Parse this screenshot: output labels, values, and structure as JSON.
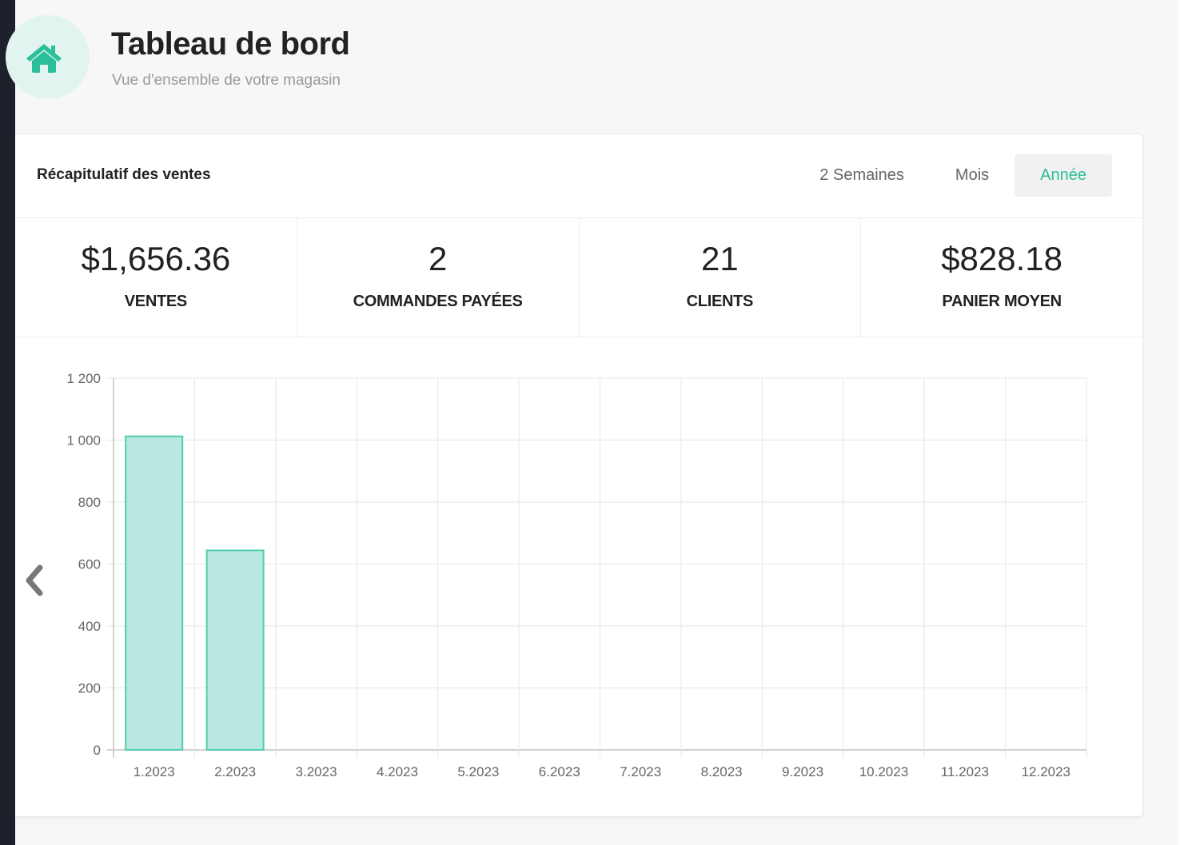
{
  "header": {
    "icon": "home-icon",
    "title": "Tableau de bord",
    "subtitle": "Vue d'ensemble de votre magasin"
  },
  "summary": {
    "title": "Récapitulatif des ventes",
    "period_tabs": [
      {
        "label": "2 Semaines",
        "active": false
      },
      {
        "label": "Mois",
        "active": false
      },
      {
        "label": "Année",
        "active": true
      }
    ],
    "stats": [
      {
        "value": "$1,656.36",
        "label": "VENTES"
      },
      {
        "value": "2",
        "label": "COMMANDES PAYÉES"
      },
      {
        "value": "21",
        "label": "CLIENTS"
      },
      {
        "value": "$828.18",
        "label": "PANIER MOYEN"
      }
    ],
    "prev_icon": "chevron-left-icon"
  },
  "colors": {
    "accent": "#2bbf99",
    "bar_fill": "#b9e8e0",
    "bar_border": "#4fcdb0"
  },
  "chart_data": {
    "type": "bar",
    "title": "",
    "xlabel": "",
    "ylabel": "",
    "categories": [
      "1.2023",
      "2.2023",
      "3.2023",
      "4.2023",
      "5.2023",
      "6.2023",
      "7.2023",
      "8.2023",
      "9.2023",
      "10.2023",
      "11.2023",
      "12.2023"
    ],
    "values": [
      1012,
      644,
      0,
      0,
      0,
      0,
      0,
      0,
      0,
      0,
      0,
      0
    ],
    "ylim": [
      0,
      1200
    ],
    "yticks": [
      0,
      200,
      400,
      600,
      800,
      1000,
      1200
    ],
    "ytick_labels": [
      "0",
      "200",
      "400",
      "600",
      "800",
      "1 000",
      "1 200"
    ],
    "grid": true,
    "legend": "none"
  }
}
